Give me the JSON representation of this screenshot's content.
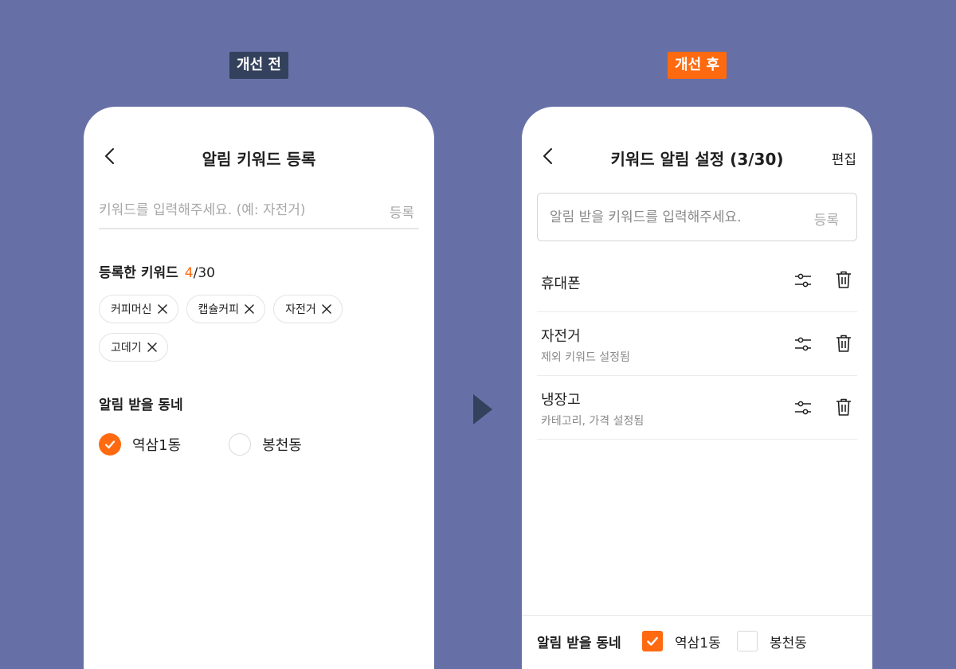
{
  "before": {
    "badge": "개선 전",
    "header": {
      "title": "알림 키워드 등록"
    },
    "input": {
      "placeholder": "키워드를 입력해주세요. (예: 자전거)",
      "register_label": "등록"
    },
    "registered": {
      "title": "등록한 키워드",
      "count_current": "4",
      "count_rest": "/30",
      "chips": [
        "커피머신",
        "캡슐커피",
        "자전거",
        "고데기"
      ]
    },
    "neighborhood": {
      "title": "알림 받을 동네",
      "options": [
        {
          "label": "역삼1동",
          "checked": true
        },
        {
          "label": "봉천동",
          "checked": false
        }
      ]
    }
  },
  "after": {
    "badge": "개선 후",
    "header": {
      "title": "키워드 알림 설정 (3/30)",
      "edit_label": "편집"
    },
    "input": {
      "placeholder": "알림 받을 키워드를 입력해주세요.",
      "register_label": "등록"
    },
    "keywords": [
      {
        "name": "휴대폰",
        "sub": ""
      },
      {
        "name": "자전거",
        "sub": "제외 키워드 설정됨"
      },
      {
        "name": "냉장고",
        "sub": "카테고리, 가격 설정됨"
      }
    ],
    "neighborhood": {
      "title": "알림 받을 동네",
      "options": [
        {
          "label": "역삼1동",
          "checked": true
        },
        {
          "label": "봉천동",
          "checked": false
        }
      ]
    }
  },
  "colors": {
    "background": "#6670a6",
    "accent": "#ff6a10",
    "dark_badge": "#34415c"
  },
  "icons": [
    "chevron-left-icon",
    "close-icon",
    "check-icon",
    "filter-icon",
    "trash-icon",
    "play-arrow-icon"
  ]
}
